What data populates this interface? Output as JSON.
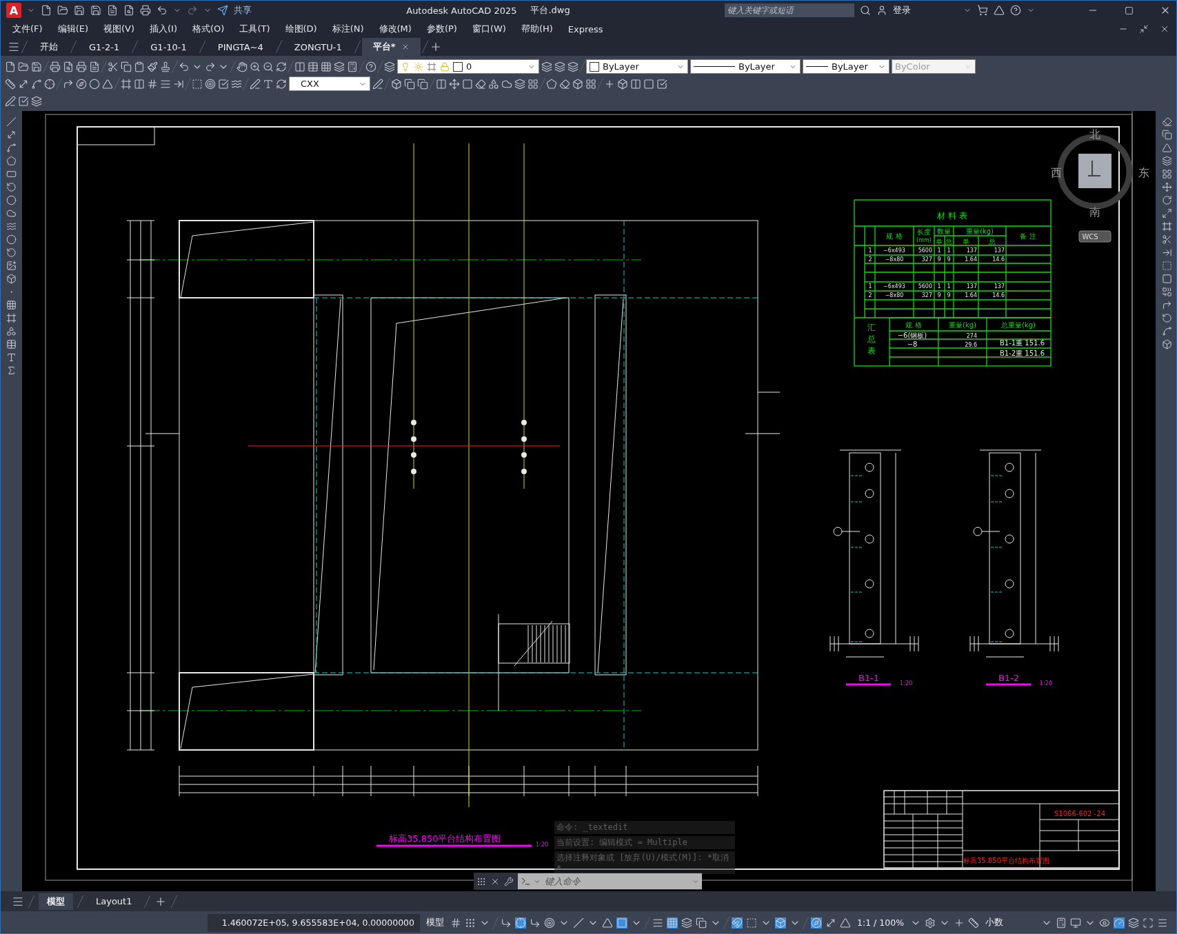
{
  "title_bar": {
    "logo": "A",
    "share": "共享",
    "app_title": "Autodesk AutoCAD 2025",
    "file_name": "平台.dwg",
    "search": {
      "placeholder": "键入关键字或短语"
    },
    "sign_in": "登录"
  },
  "menu": [
    "文件(F)",
    "编辑(E)",
    "视图(V)",
    "插入(I)",
    "格式(O)",
    "工具(T)",
    "绘图(D)",
    "标注(N)",
    "修改(M)",
    "参数(P)",
    "窗口(W)",
    "帮助(H)",
    "Express"
  ],
  "file_tabs": [
    {
      "label": "开始",
      "selected": false
    },
    {
      "label": "G1-2-1",
      "selected": false
    },
    {
      "label": "G1-10-1",
      "selected": false
    },
    {
      "label": "PINGTA~4",
      "selected": false
    },
    {
      "label": "ZONGTU-1",
      "selected": false
    },
    {
      "label": "平台*",
      "selected": true
    }
  ],
  "toolbars": {
    "layer": "0",
    "text_style": "CXX",
    "properties": [
      {
        "kind": "color",
        "value": "ByLayer",
        "disabled": false
      },
      {
        "kind": "linetype",
        "value": "ByLayer",
        "disabled": false
      },
      {
        "kind": "lineweight",
        "value": "ByLayer",
        "disabled": false
      },
      {
        "kind": "plotstyle",
        "value": "ByColor",
        "disabled": true
      }
    ]
  },
  "drawing": {
    "compass": {
      "north": "北",
      "south": "南",
      "east": "东",
      "west": "西",
      "ucs": "WCS"
    },
    "material_table": {
      "title": "材 料 表",
      "headers": [
        [
          "规 格"
        ],
        [
          "长度",
          "(mm)"
        ],
        [
          "数量"
        ],
        [
          "重量(kg)"
        ],
        [
          "备 注"
        ]
      ],
      "subheaders": [
        "单",
        "总",
        "单",
        "总"
      ],
      "groups": [
        {
          "rows": [
            [
              "1",
              "−6x493",
              "5600",
              "1",
              "1",
              "137",
              "137"
            ],
            [
              "2",
              "−8x80",
              "327",
              "9",
              "9",
              "1.64",
              "14.6"
            ]
          ]
        },
        {
          "rows": [
            [
              "1",
              "−6x493",
              "5600",
              "1",
              "1",
              "137",
              "137"
            ],
            [
              "2",
              "−8x80",
              "327",
              "9",
              "9",
              "1.64",
              "14.6"
            ]
          ]
        }
      ],
      "summary": {
        "title": "汇总表",
        "headers": [
          "规 格",
          "重量(kg)",
          "总重量(kg)"
        ],
        "rows": [
          [
            "−6(钢板)",
            "274"
          ],
          [
            "−8",
            "29.6"
          ]
        ],
        "totals": [
          "B1-1重 151.6",
          "B1-2重 151.6"
        ]
      }
    },
    "sections": [
      {
        "label": "B1-1",
        "scale": "1:20"
      },
      {
        "label": "B1-2",
        "scale": "1:20"
      }
    ],
    "plan_title": "标高35.850平台结构布置图",
    "plan_scale": "1:20",
    "title_block": {
      "drawing_number": "S1066-602 -24",
      "drawing_title": "标高35.850平台结构布置图"
    }
  },
  "command_history": [
    "命令: _textedit",
    "当前设置: 编辑模式 = Multiple",
    "选择注释对象或 [放弃(U)/模式(M)]: *取消*"
  ],
  "command_line": {
    "placeholder": "键入命令"
  },
  "layout_tabs": [
    {
      "label": "模型",
      "selected": true
    },
    {
      "label": "Layout1",
      "selected": false
    }
  ],
  "status_bar": {
    "coordinates": "1.460072E+05, 9.655583E+04, 0.00000000",
    "space": "模型",
    "annotation_scale": "1:1 / 100%",
    "units": "小数"
  }
}
